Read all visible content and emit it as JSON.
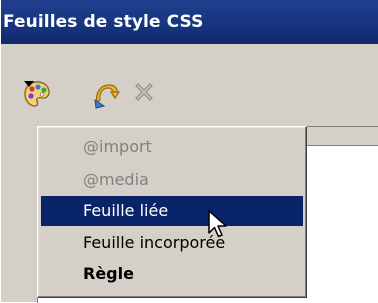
{
  "window": {
    "title": "Feuilles de style CSS"
  },
  "toolbar": {
    "buttons": [
      {
        "icon": "palette-icon",
        "has_dropdown": true
      },
      {
        "icon": "wizard-icon"
      },
      {
        "icon": "delete-icon",
        "disabled": true
      }
    ]
  },
  "menu": {
    "items": [
      {
        "label": "@import",
        "state": "disabled"
      },
      {
        "label": "@media",
        "state": "disabled"
      },
      {
        "label": "Feuille liée",
        "state": "selected"
      },
      {
        "label": "Feuille incorporée",
        "state": "normal"
      },
      {
        "label": "Règle",
        "state": "bold"
      }
    ]
  },
  "colors": {
    "titlebar": "#173580",
    "selection": "#0a246a",
    "disabled_text": "#808080",
    "chrome": "#d4d0c8"
  }
}
